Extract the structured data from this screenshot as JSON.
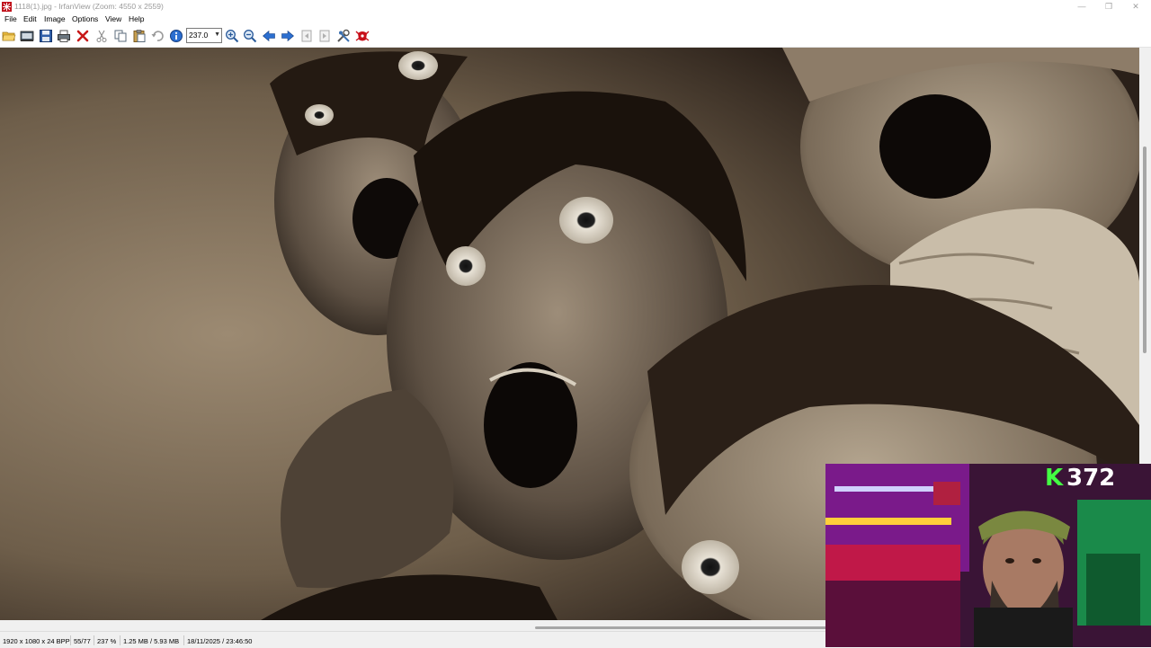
{
  "window": {
    "title": "1118(1).jpg - IrfanView (Zoom: 4550 x 2559)",
    "controls": [
      "minimize-icon",
      "maximize-icon",
      "close-icon"
    ]
  },
  "menu": {
    "items": [
      "File",
      "Edit",
      "Image",
      "Options",
      "View",
      "Help"
    ]
  },
  "toolbar": {
    "icons": [
      "open-folder-icon",
      "thumbnails-icon",
      "save-icon",
      "print-icon",
      "delete-icon",
      "cut-icon",
      "copy-icon",
      "paste-icon",
      "undo-icon",
      "info-icon",
      "zoom-in-icon",
      "zoom-out-icon",
      "previous-icon",
      "next-icon",
      "first-page-icon",
      "last-page-icon",
      "settings-icon",
      "irfanview-logo-icon"
    ],
    "zoom_value": "237.0"
  },
  "viewer": {
    "image_description_icon": "photo-image"
  },
  "statusbar": {
    "dimensions": "1920 x 1080 x 24 BPP",
    "position": "55/77",
    "zoom": "237 %",
    "filesize": "1.25 MB / 5.93 MB",
    "datetime": "18/11/2025 / 23:46:50"
  },
  "overlay": {
    "counter_letter": "K",
    "counter_value": "372"
  },
  "colors": {
    "counter_accent": "#43ff43",
    "webcam_bg": "#2a0f2a"
  }
}
